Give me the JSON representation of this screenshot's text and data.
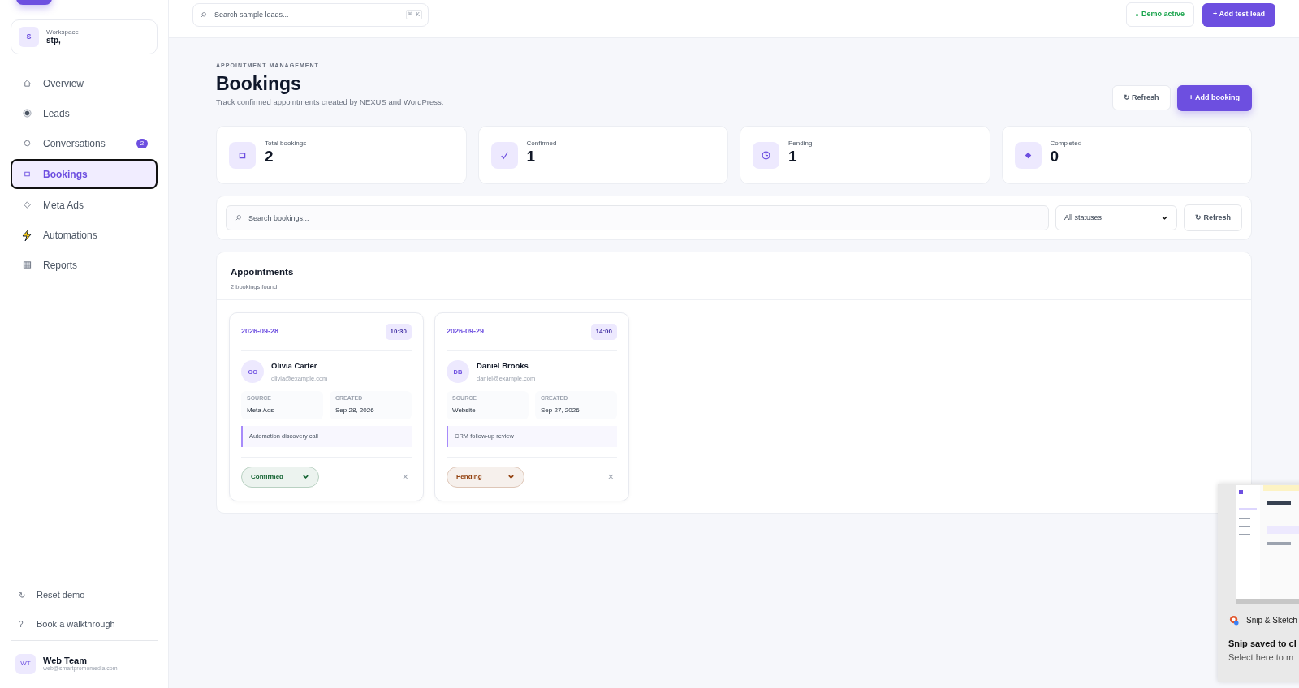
{
  "workspace": {
    "avatar": "S",
    "label": "Workspace",
    "name": "stp,"
  },
  "nav": [
    {
      "kind": "home",
      "label": "Overview",
      "selected": false
    },
    {
      "kind": "dot",
      "label": "Leads",
      "selected": false
    },
    {
      "kind": "circle",
      "label": "Conversations",
      "selected": false,
      "badge": "2"
    },
    {
      "kind": "square",
      "label": "Bookings",
      "selected": true
    },
    {
      "kind": "diamond",
      "label": "Meta Ads",
      "selected": false
    },
    {
      "kind": "bolt",
      "label": "Automations",
      "selected": false
    },
    {
      "kind": "grid",
      "label": "Reports",
      "selected": false
    }
  ],
  "sidebar_footer": [
    {
      "icon": "↻",
      "label": "Reset demo"
    },
    {
      "icon": "?",
      "label": "Book a walkthrough"
    }
  ],
  "user": {
    "initials": "WT",
    "name": "Web Team",
    "email": "web@smartpromomedia.com"
  },
  "topbar": {
    "search_placeholder": "Search sample leads...",
    "shortcut": "⌘ K",
    "status": "Demo active",
    "add_button": "+ Add test lead"
  },
  "header": {
    "eyebrow": "APPOINTMENT MANAGEMENT",
    "title": "Bookings",
    "subtitle": "Track confirmed appointments created by NEXUS and WordPress.",
    "refresh": "↻ Refresh",
    "add": "+ Add booking"
  },
  "stats": [
    {
      "kind": "square",
      "label": "Total bookings",
      "value": "2"
    },
    {
      "kind": "check",
      "label": "Confirmed",
      "value": "1"
    },
    {
      "kind": "clock",
      "label": "Pending",
      "value": "1"
    },
    {
      "kind": "diamond",
      "label": "Completed",
      "value": "0"
    }
  ],
  "filters": {
    "search_placeholder": "Search bookings...",
    "status": "All statuses",
    "refresh": "↻ Refresh"
  },
  "appointments": {
    "title": "Appointments",
    "count": "2 bookings found",
    "bookings": [
      {
        "date": "2026-09-28",
        "time": "10:30",
        "initials": "OC",
        "name": "Olivia Carter",
        "email": "olivia@example.com",
        "source_label": "SOURCE",
        "source": "Meta Ads",
        "created_label": "CREATED",
        "created": "Sep 28, 2026",
        "note": "Automation discovery call",
        "status": "Confirmed",
        "color": "#166534",
        "remove": "×"
      },
      {
        "date": "2026-09-29",
        "time": "14:00",
        "initials": "DB",
        "name": "Daniel Brooks",
        "email": "daniel@example.com",
        "source_label": "SOURCE",
        "source": "Website",
        "created_label": "CREATED",
        "created": "Sep 27, 2026",
        "note": "CRM follow-up review",
        "status": "Pending",
        "color": "#92400e",
        "remove": "×"
      }
    ]
  },
  "notification": {
    "app": "Snip & Sketch",
    "title": "Snip saved to cl",
    "body": "Select here to m"
  }
}
